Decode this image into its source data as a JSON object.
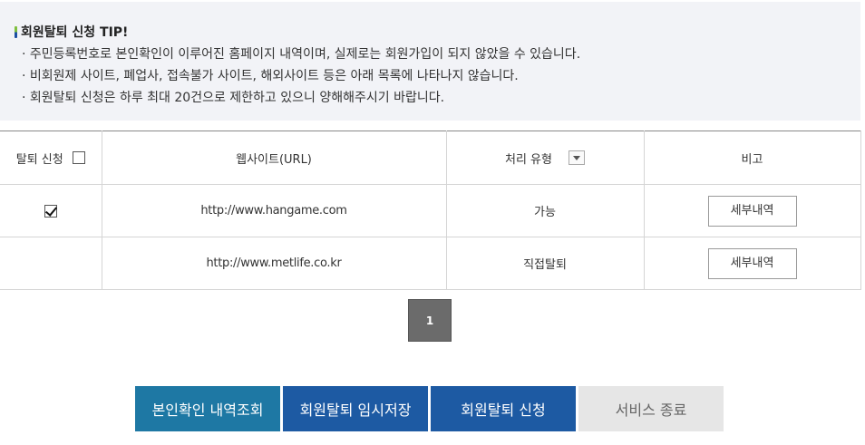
{
  "tip": {
    "title": "회원탈퇴 신청 TIP!",
    "lines": [
      "· 주민등록번호로 본인확인이 이루어진 홈페이지 내역이며, 실제로는 회원가입이 되지 않았을 수 있습니다.",
      "· 비회원제 사이트, 폐업사, 접속불가 사이트, 해외사이트 등은 아래 목록에 나타나지 않습니다.",
      "· 회원탈퇴 신청은 하루 최대 20건으로 제한하고 있으니 양해해주시기 바랍니다."
    ]
  },
  "table": {
    "headers": {
      "apply": "탈퇴 신청",
      "url": "웹사이트(URL)",
      "type": "처리 유형",
      "note": "비고"
    },
    "rows": [
      {
        "checked": true,
        "url": "http://www.hangame.com",
        "type": "가능",
        "detail": "세부내역"
      },
      {
        "checked": false,
        "url": "http://www.metlife.co.kr",
        "type": "직접탈퇴",
        "detail": "세부내역"
      }
    ]
  },
  "pagination": {
    "current": "1"
  },
  "buttons": {
    "history": "본인확인 내역조회",
    "temp_save": "회원탈퇴 임시저장",
    "apply": "회원탈퇴 신청",
    "exit": "서비스 종료"
  }
}
